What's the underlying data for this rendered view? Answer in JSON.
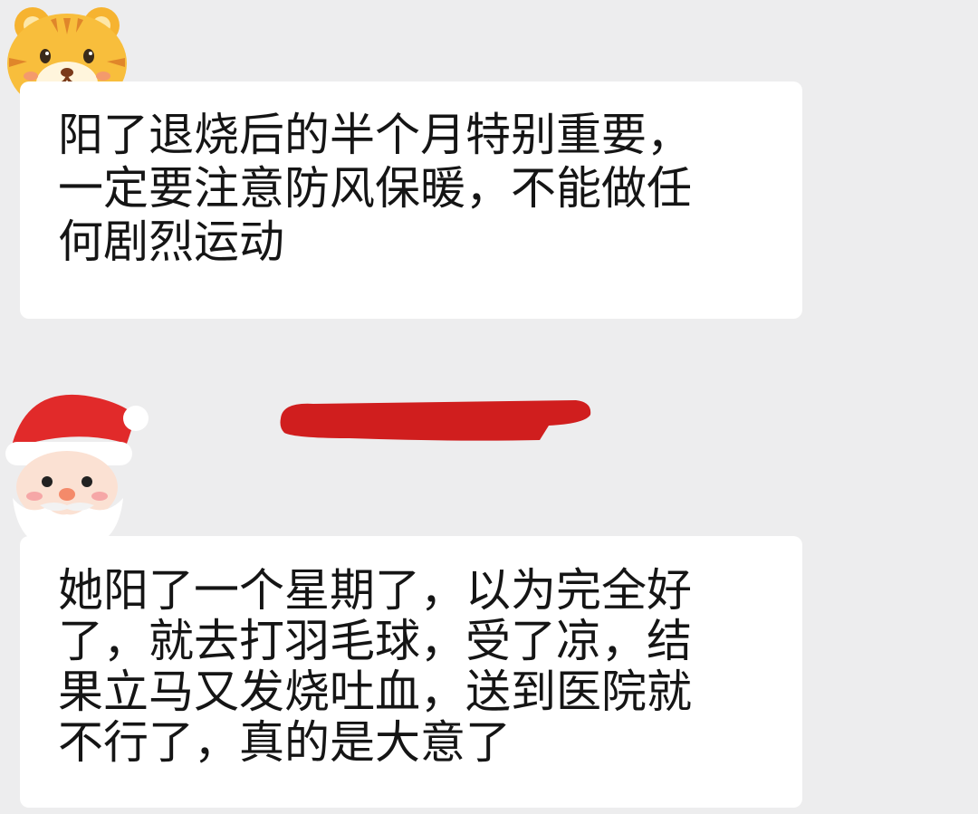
{
  "messages": [
    {
      "sender_avatar": "tiger-avatar",
      "lines": [
        "阳了退烧后的半个月特别重要，",
        "一定要注意防风保暖，不能做任",
        "何剧烈运动"
      ]
    },
    {
      "sender_avatar": "santa-avatar",
      "sender_name_redacted": true,
      "lines": [
        "她阳了一个星期了，以为完全好",
        "了，就去打羽毛球，受了凉，结",
        "果立马又发烧吐血，送到医院就",
        "不行了，真的是大意了"
      ]
    }
  ],
  "colors": {
    "background": "#ededee",
    "bubble": "#ffffff",
    "text": "#151515",
    "redaction": "#d01e1e"
  }
}
